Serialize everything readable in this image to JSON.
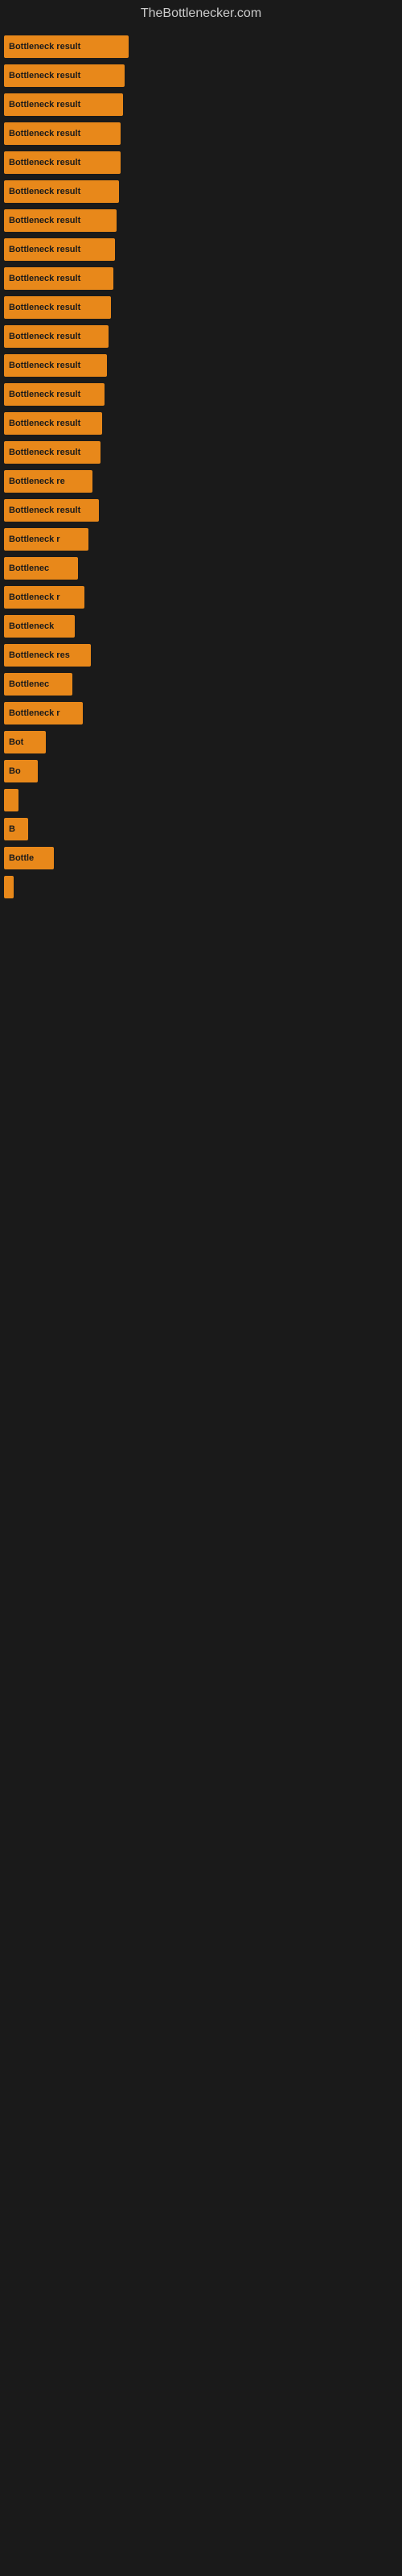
{
  "site": {
    "title": "TheBottlenecker.com"
  },
  "bars": [
    {
      "label": "Bottleneck result",
      "width": 155
    },
    {
      "label": "Bottleneck result",
      "width": 150
    },
    {
      "label": "Bottleneck result",
      "width": 148
    },
    {
      "label": "Bottleneck result",
      "width": 145
    },
    {
      "label": "Bottleneck result",
      "width": 145
    },
    {
      "label": "Bottleneck result",
      "width": 143
    },
    {
      "label": "Bottleneck result",
      "width": 140
    },
    {
      "label": "Bottleneck result",
      "width": 138
    },
    {
      "label": "Bottleneck result",
      "width": 136
    },
    {
      "label": "Bottleneck result",
      "width": 133
    },
    {
      "label": "Bottleneck result",
      "width": 130
    },
    {
      "label": "Bottleneck result",
      "width": 128
    },
    {
      "label": "Bottleneck result",
      "width": 125
    },
    {
      "label": "Bottleneck result",
      "width": 122
    },
    {
      "label": "Bottleneck result",
      "width": 120
    },
    {
      "label": "Bottleneck re",
      "width": 110
    },
    {
      "label": "Bottleneck result",
      "width": 118
    },
    {
      "label": "Bottleneck r",
      "width": 105
    },
    {
      "label": "Bottlenec",
      "width": 92
    },
    {
      "label": "Bottleneck r",
      "width": 100
    },
    {
      "label": "Bottleneck",
      "width": 88
    },
    {
      "label": "Bottleneck res",
      "width": 108
    },
    {
      "label": "Bottlenec",
      "width": 85
    },
    {
      "label": "Bottleneck r",
      "width": 98
    },
    {
      "label": "Bot",
      "width": 52
    },
    {
      "label": "Bo",
      "width": 42
    },
    {
      "label": "",
      "width": 18
    },
    {
      "label": "B",
      "width": 30
    },
    {
      "label": "Bottle",
      "width": 62
    },
    {
      "label": "",
      "width": 12
    }
  ]
}
